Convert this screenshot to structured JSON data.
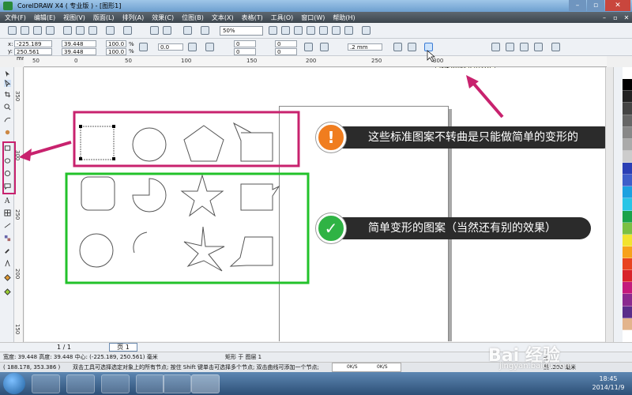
{
  "window": {
    "title": "CorelDRAW X4 ( 专业版 ) - [图形1]",
    "min": "–",
    "max": "▫",
    "close": "✕"
  },
  "menu": [
    "文件(F)",
    "编辑(E)",
    "视图(V)",
    "版面(L)",
    "排列(A)",
    "效果(C)",
    "位图(B)",
    "文本(X)",
    "表格(T)",
    "工具(O)",
    "窗口(W)",
    "帮助(H)"
  ],
  "toolbar": {
    "zoom": "50%"
  },
  "propbar": {
    "x": "-225.189 mm",
    "y": "250.561 mm",
    "w": "39.448 mm",
    "h": "39.448 mm",
    "sx": "100.0",
    "sy": "100.0",
    "pct": "%",
    "rot": "0.0",
    "outline": ".2 mm",
    "n1": "0",
    "n2": "0",
    "n3": "0",
    "n4": "0",
    "x_label": "x:",
    "y_label": "y:"
  },
  "tooltip": "转换为曲线 (Ctrl+Q)",
  "ruler": {
    "top": [
      "50",
      "0",
      "50",
      "100",
      "150",
      "200",
      "250",
      "300"
    ],
    "left": [
      "350",
      "300",
      "250",
      "200",
      "150"
    ]
  },
  "doc_nav": {
    "page_count": "1 / 1",
    "page_tab": "页 1"
  },
  "status": {
    "size": "宽度: 39.448 高度: 39.448 中心: (-225.189, 250.561) 毫米",
    "layer": "矩形 于 图层 1",
    "coords": "( 188.178, 353.386 )",
    "hint": "双击工具可选择选定对象上的所有节点; 按住 Shift 键单击可选择多个节点; 双击曲线可添加一个节点;",
    "rate1": "0K/S",
    "rate2": "0K/S",
    "fill": "无",
    "outline": "黑 .200 毫米"
  },
  "callouts": {
    "warn_text": "这些标准图案不转曲是只能做简单的变形的",
    "warn_badge": "!",
    "ok_text": "简单变形的图案（当然还有别的效果）",
    "ok_badge": "✓"
  },
  "taskbar": {
    "time": "18:45",
    "date": "2014/11/9"
  },
  "watermark": {
    "brand": "Bai 经验",
    "url": "jingyan.baidu.com"
  },
  "colors": {
    "pink": "#c8226e",
    "green": "#22c22a",
    "orange": "#f07d1f",
    "check": "#2fb344"
  }
}
